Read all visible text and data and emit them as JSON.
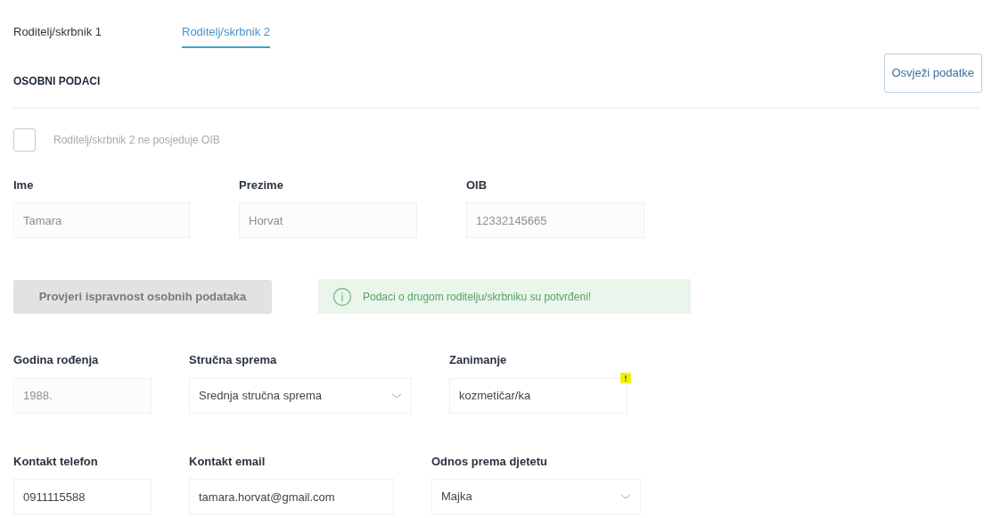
{
  "tabs": [
    {
      "label": "Roditelj/skrbnik 1",
      "selected": false
    },
    {
      "label": "Roditelj/skrbnik 2",
      "selected": true
    }
  ],
  "refresh_button": "Osvježi podatke",
  "section_title": "OSOBNI PODACI",
  "no_oib_checkbox": {
    "label": "Roditelj/skrbnik 2 ne posjeduje OIB",
    "checked": false,
    "disabled": true
  },
  "row_1": [
    {
      "label": "Ime",
      "value": "Tamara",
      "kind": "text",
      "disabled": true
    },
    {
      "label": "Prezime",
      "value": "Horvat",
      "kind": "text",
      "disabled": true
    },
    {
      "label": "OIB",
      "value": "12332145665",
      "kind": "text",
      "disabled": true
    }
  ],
  "verify_button": {
    "label": "Provjeri ispravnost osobnih podataka",
    "disabled": true
  },
  "success_alert": "Podaci o drugom roditelju/skrbniku su potvrđeni!",
  "row_2": [
    {
      "label": "Godina rođenja",
      "value": "1988.",
      "kind": "text",
      "disabled": true
    },
    {
      "label": "Stručna sprema",
      "value": "Srednja stručna sprema",
      "kind": "select",
      "disabled": false
    },
    {
      "label": "Zanimanje",
      "value": "kozmetičar/ka",
      "kind": "text",
      "disabled": false,
      "flagged": true
    }
  ],
  "row_3": [
    {
      "label": "Kontakt telefon",
      "value": "0911115588",
      "kind": "text",
      "disabled": false
    },
    {
      "label": "Kontakt email",
      "value": "tamara.horvat@gmail.com",
      "kind": "text",
      "disabled": false
    },
    {
      "label": "Odnos prema djetetu",
      "value": "Majka",
      "kind": "select",
      "disabled": false
    }
  ]
}
